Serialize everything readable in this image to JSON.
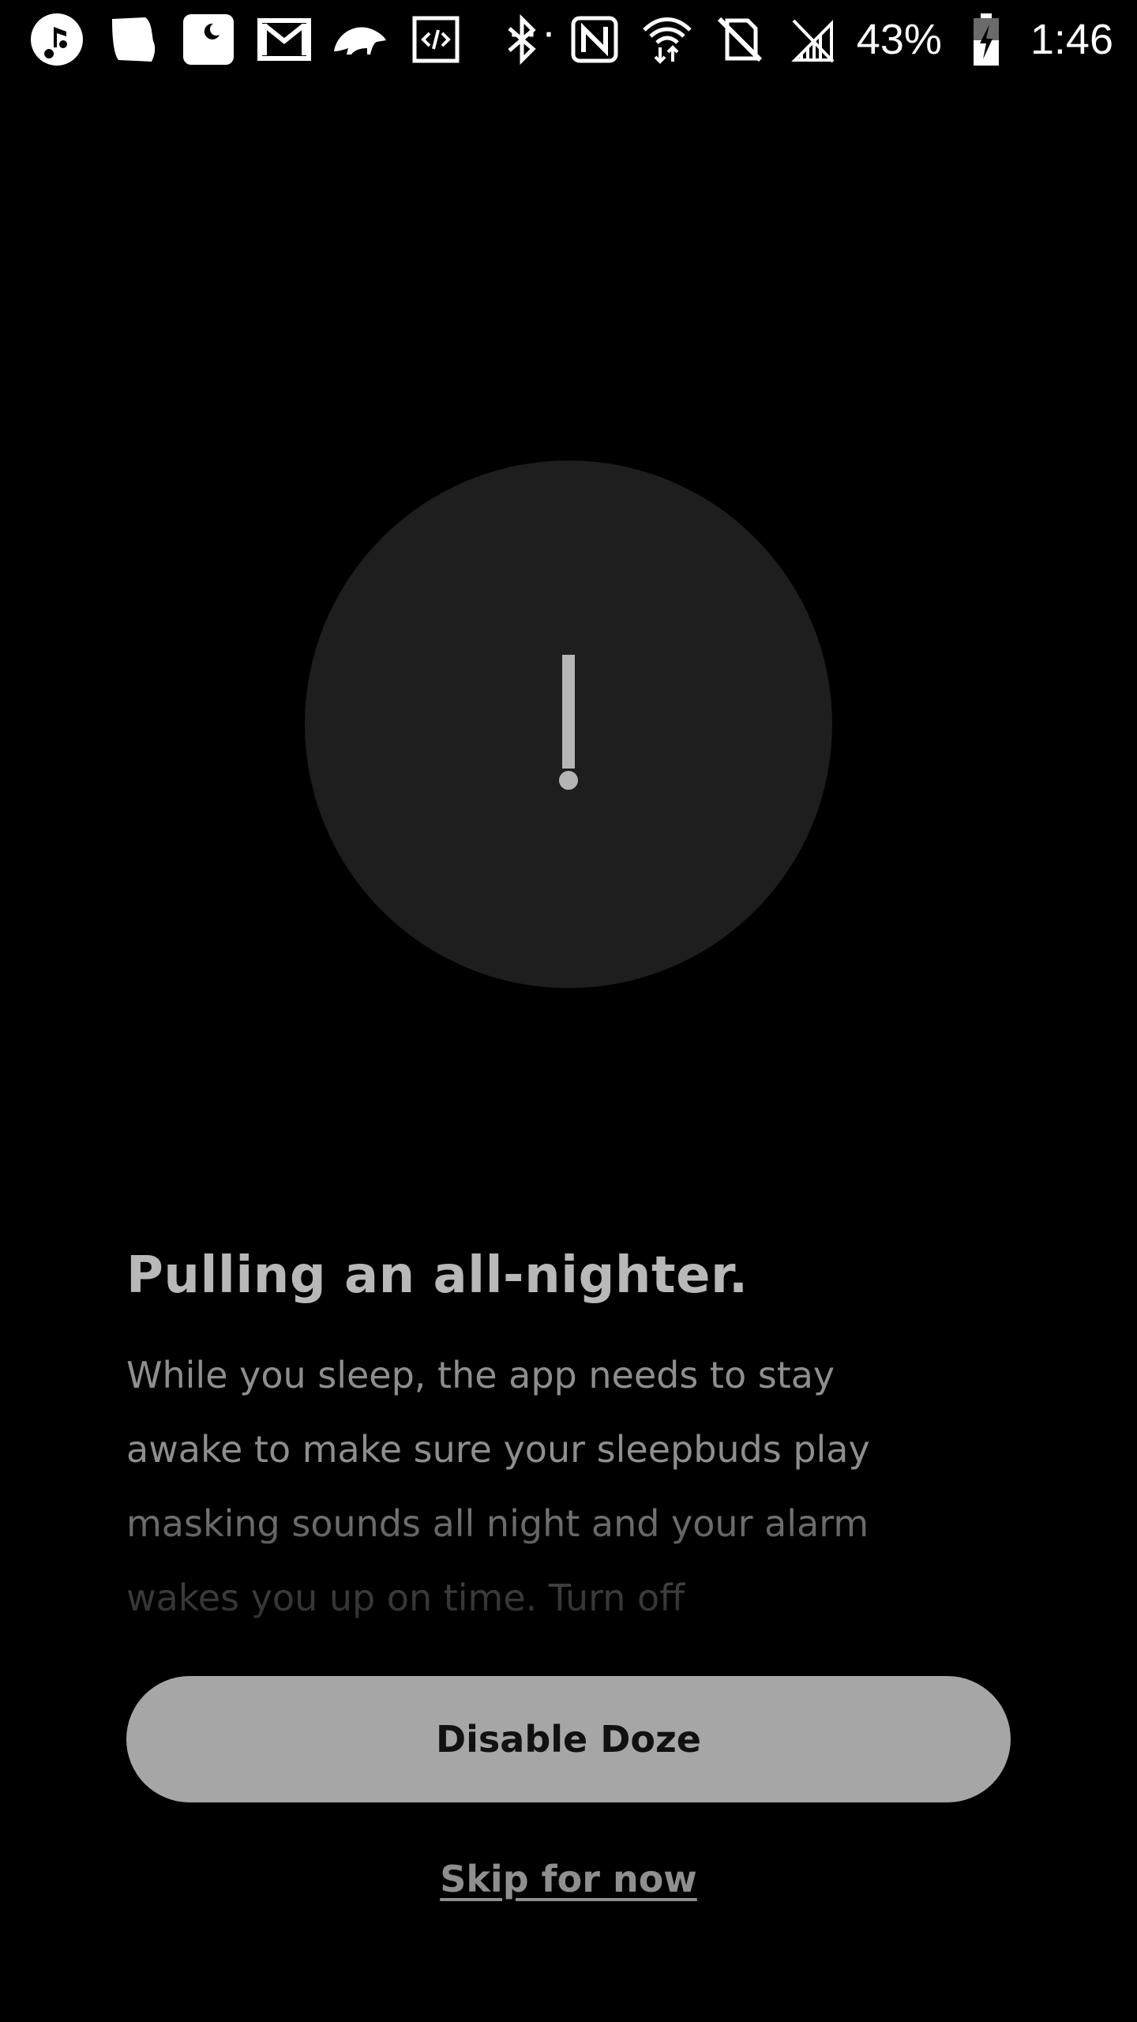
{
  "status_bar": {
    "left_icons": [
      "spotify-like-icon",
      "cloud-icon",
      "moon-card-icon",
      "gmail-icon",
      "sloth-icon",
      "code-icon"
    ],
    "overflow": "···",
    "right_icons": [
      "bluetooth-icon",
      "nfc-icon",
      "wifi-icon",
      "no-sim-icon",
      "signal-icon"
    ],
    "battery": "43%",
    "time": "1:46"
  },
  "alert": {
    "icon": "exclamation-icon",
    "colors": {
      "circle": "#1e1e1e",
      "glyph": "#b5b5b5"
    }
  },
  "content": {
    "title": "Pulling an all-nighter.",
    "body": "While you sleep, the app needs to stay awake to make sure your sleepbuds play masking sounds all night and your alarm wakes you up on time. Turn off"
  },
  "actions": {
    "primary_label": "Disable Doze",
    "secondary_label": "Skip for now"
  },
  "colors": {
    "background": "#000000",
    "button": "#a6a6a6",
    "title": "#b8b8b8",
    "body": "#8e8e8e"
  }
}
